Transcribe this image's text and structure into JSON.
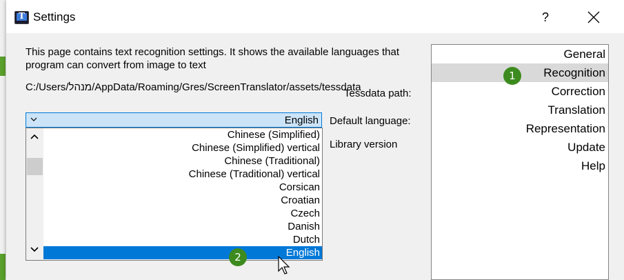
{
  "window": {
    "title": "Settings",
    "help_label": "?",
    "close_icon": "close-icon"
  },
  "recognition": {
    "description": "This page contains text recognition settings. It shows the available languages that program can convert from image to text",
    "tessdata_path_value": "C:/Users/מנהל/AppData/Roaming/Gres/ScreenTranslator/assets/tessdata",
    "tessdata_path_label": "Tessdata path:",
    "default_language_label": "Default language:",
    "library_version_label": "Library version",
    "default_language_value": "English",
    "language_options": [
      "Chinese (Simplified)",
      "Chinese (Simplified) vertical",
      "Chinese (Traditional)",
      "Chinese (Traditional) vertical",
      "Corsican",
      "Croatian",
      "Czech",
      "Danish",
      "Dutch",
      "English"
    ],
    "selected_option": "English"
  },
  "nav": {
    "items": [
      "General",
      "Recognition",
      "Correction",
      "Translation",
      "Representation",
      "Update",
      "Help"
    ],
    "active": "Recognition"
  },
  "badges": {
    "first": "1",
    "second": "2"
  },
  "colors": {
    "accent": "#0078d7",
    "badge": "#3d8b1f",
    "selection_bg": "#cce4f7"
  }
}
